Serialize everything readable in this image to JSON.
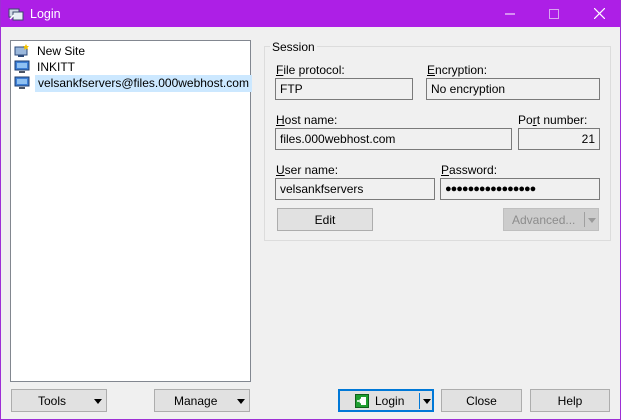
{
  "window": {
    "title": "Login"
  },
  "sites": [
    {
      "label": "New Site",
      "icon": "new-site-icon"
    },
    {
      "label": "INKITT",
      "icon": "computer-icon"
    },
    {
      "label": "velsankfservers@files.000webhost.com",
      "icon": "computer-icon",
      "selected": true
    }
  ],
  "session": {
    "group_title": "Session",
    "file_protocol": {
      "label_key": "F",
      "label_rest": "ile protocol:",
      "value": "FTP"
    },
    "encryption": {
      "label_key": "E",
      "label_rest": "ncryption:",
      "value": "No encryption"
    },
    "host_name": {
      "label_key": "H",
      "label_rest": "ost name:",
      "value": "files.000webhost.com"
    },
    "port_number": {
      "label_key": "r",
      "label_pre": "Po",
      "label_rest": "t number:",
      "value": "21"
    },
    "user_name": {
      "label_key": "U",
      "label_rest": "ser name:",
      "value": "velsankfservers"
    },
    "password": {
      "label_key": "P",
      "label_rest": "assword:",
      "value": "●●●●●●●●●●●●●●●●"
    },
    "edit_label": "Edit",
    "advanced_label": "Advanced..."
  },
  "bottom": {
    "tools_label": "Tools",
    "manage_label": "Manage",
    "login_label": "Login",
    "close_label": "Close",
    "help_label": "Help"
  },
  "colors": {
    "titlebar": "#ad1fe6",
    "selection": "#cce8ff",
    "focus": "#0078d7",
    "login_icon": "#1e9e2f"
  }
}
